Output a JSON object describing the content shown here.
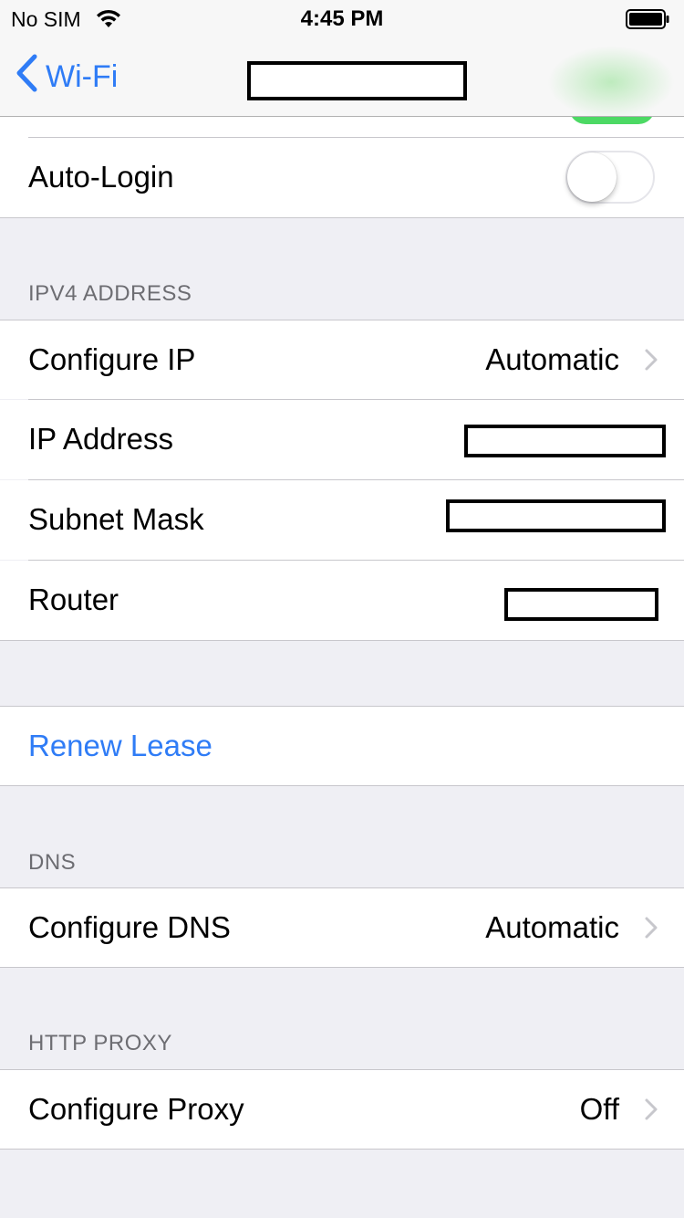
{
  "status_bar": {
    "carrier": "No SIM",
    "time": "4:45 PM",
    "wifi_icon": "wifi-icon",
    "battery_icon": "battery-icon"
  },
  "nav": {
    "back_label": "Wi-Fi",
    "back_icon": "chevron-left-icon",
    "title_redacted": true
  },
  "top_section": {
    "auto_login_label": "Auto-Login",
    "auto_login_on": false,
    "previous_toggle_on": true
  },
  "ipv4": {
    "header": "IPV4 ADDRESS",
    "configure_ip_label": "Configure IP",
    "configure_ip_value": "Automatic",
    "ip_address_label": "IP Address",
    "subnet_mask_label": "Subnet Mask",
    "router_label": "Router"
  },
  "renew": {
    "label": "Renew Lease"
  },
  "dns": {
    "header": "DNS",
    "configure_dns_label": "Configure DNS",
    "configure_dns_value": "Automatic"
  },
  "proxy": {
    "header": "HTTP PROXY",
    "configure_proxy_label": "Configure Proxy",
    "configure_proxy_value": "Off"
  },
  "colors": {
    "accent": "#2f7cf6",
    "group_background": "#efeff4",
    "toggle_on": "#4cd964"
  }
}
